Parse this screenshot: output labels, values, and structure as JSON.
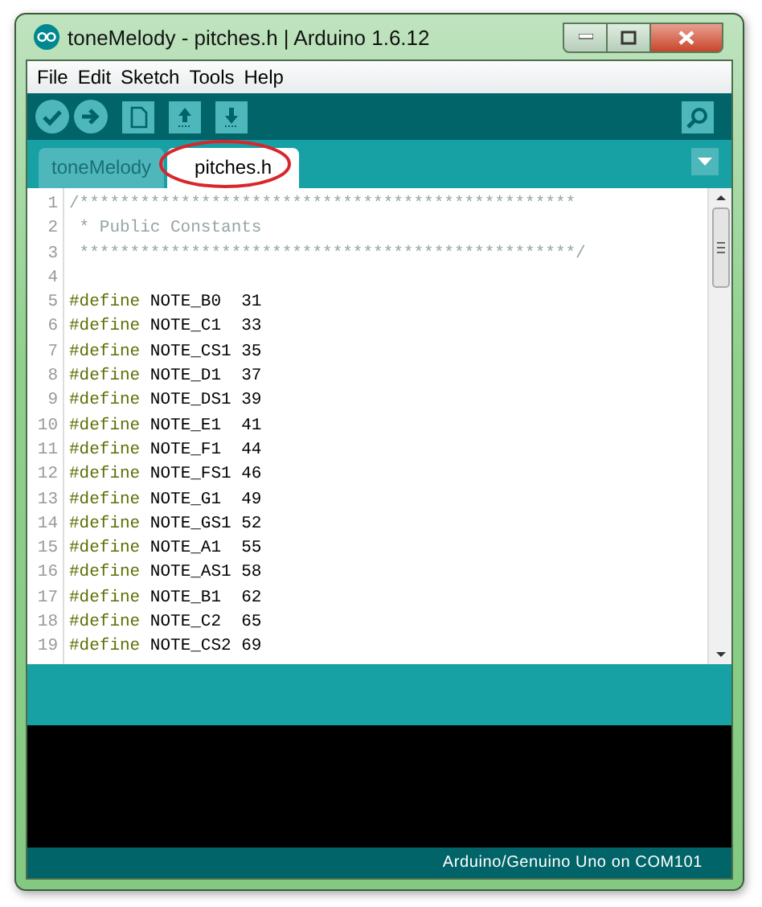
{
  "window": {
    "title": "toneMelody - pitches.h | Arduino 1.6.12"
  },
  "menu": [
    "File",
    "Edit",
    "Sketch",
    "Tools",
    "Help"
  ],
  "tabs": [
    {
      "label": "toneMelody",
      "selected": false
    },
    {
      "label": "pitches.h",
      "selected": true
    }
  ],
  "editor": {
    "lines": [
      {
        "number": "1",
        "kind": "comment",
        "text": "/*************************************************"
      },
      {
        "number": "2",
        "kind": "comment",
        "text": " * Public Constants"
      },
      {
        "number": "3",
        "kind": "comment",
        "text": " *************************************************/"
      },
      {
        "number": "4",
        "kind": "blank"
      },
      {
        "number": "5",
        "kind": "define",
        "directive": "#define",
        "name": "NOTE_B0",
        "value": "31"
      },
      {
        "number": "6",
        "kind": "define",
        "directive": "#define",
        "name": "NOTE_C1",
        "value": "33"
      },
      {
        "number": "7",
        "kind": "define",
        "directive": "#define",
        "name": "NOTE_CS1",
        "value": "35"
      },
      {
        "number": "8",
        "kind": "define",
        "directive": "#define",
        "name": "NOTE_D1",
        "value": "37"
      },
      {
        "number": "9",
        "kind": "define",
        "directive": "#define",
        "name": "NOTE_DS1",
        "value": "39"
      },
      {
        "number": "10",
        "kind": "define",
        "directive": "#define",
        "name": "NOTE_E1",
        "value": "41"
      },
      {
        "number": "11",
        "kind": "define",
        "directive": "#define",
        "name": "NOTE_F1",
        "value": "44"
      },
      {
        "number": "12",
        "kind": "define",
        "directive": "#define",
        "name": "NOTE_FS1",
        "value": "46"
      },
      {
        "number": "13",
        "kind": "define",
        "directive": "#define",
        "name": "NOTE_G1",
        "value": "49"
      },
      {
        "number": "14",
        "kind": "define",
        "directive": "#define",
        "name": "NOTE_GS1",
        "value": "52"
      },
      {
        "number": "15",
        "kind": "define",
        "directive": "#define",
        "name": "NOTE_A1",
        "value": "55"
      },
      {
        "number": "16",
        "kind": "define",
        "directive": "#define",
        "name": "NOTE_AS1",
        "value": "58"
      },
      {
        "number": "17",
        "kind": "define",
        "directive": "#define",
        "name": "NOTE_B1",
        "value": "62"
      },
      {
        "number": "18",
        "kind": "define",
        "directive": "#define",
        "name": "NOTE_C2",
        "value": "65"
      },
      {
        "number": "19",
        "kind": "define",
        "directive": "#define",
        "name": "NOTE_CS2",
        "value": "69"
      }
    ]
  },
  "status_bar": {
    "board": "Arduino/Genuino Uno on COM101"
  }
}
